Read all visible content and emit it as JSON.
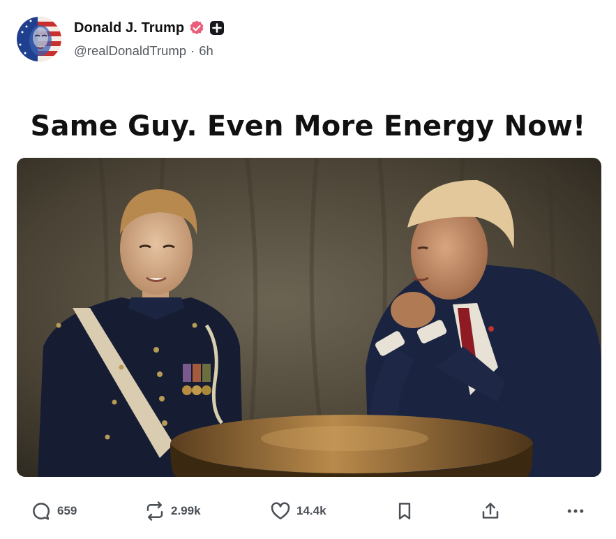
{
  "post": {
    "author": {
      "display_name": "Donald J. Trump",
      "handle": "@realDonaldTrump",
      "separator": "·",
      "time_ago": "6h"
    },
    "text": "Same Guy. Even More Energy Now!"
  },
  "actions": {
    "replies": "659",
    "reposts": "2.99k",
    "likes": "14.4k"
  },
  "colors": {
    "verified_badge": "#e85d7a",
    "icon": "#4a4f55",
    "text_primary": "#111111",
    "text_secondary": "#555a60"
  },
  "icons": [
    "verified-badge-icon",
    "plus-badge-icon",
    "reply-icon",
    "repost-icon",
    "like-icon",
    "bookmark-icon",
    "share-icon",
    "more-icon"
  ]
}
